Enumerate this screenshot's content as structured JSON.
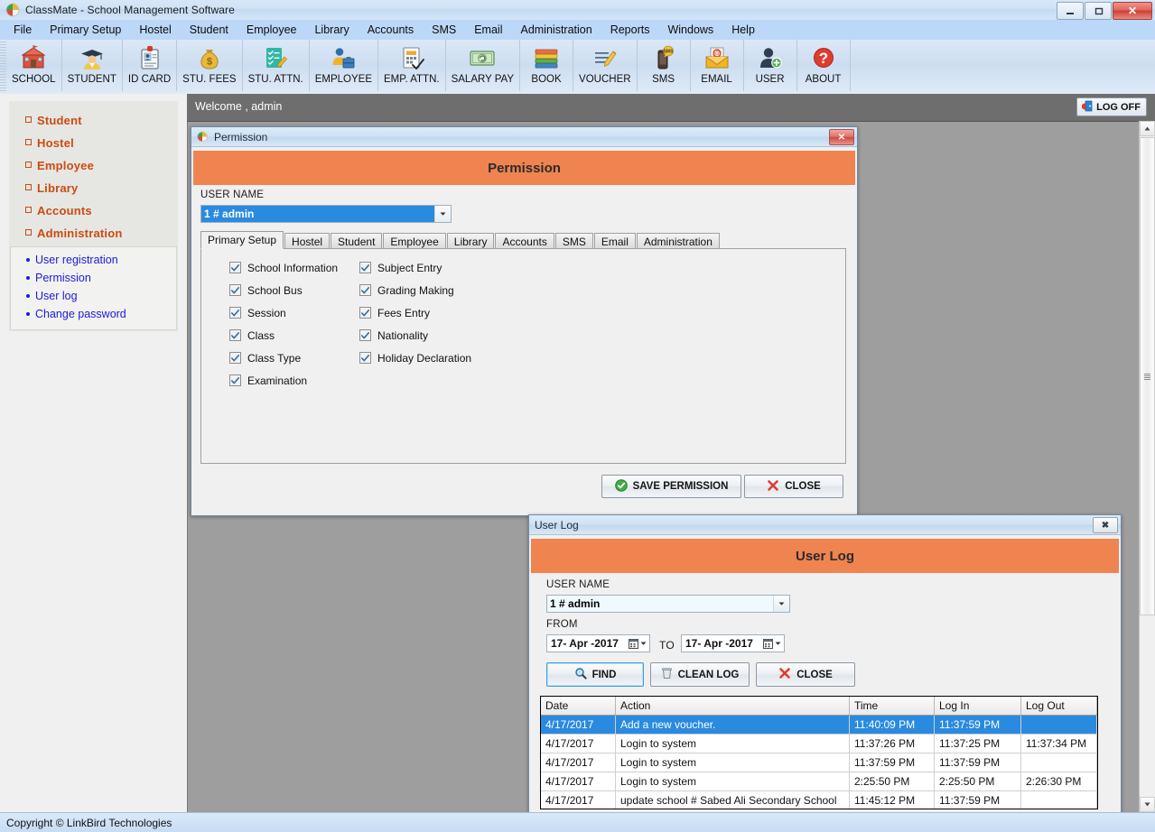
{
  "app": {
    "title": "ClassMate - School Management Software",
    "icon": "app-logo-icon",
    "window_buttons": {
      "minimize": "—",
      "maximize": "❐",
      "close": "✕"
    }
  },
  "menu": {
    "items": [
      "File",
      "Primary Setup",
      "Hostel",
      "Student",
      "Employee",
      "Library",
      "Accounts",
      "SMS",
      "Email",
      "Administration",
      "Reports",
      "Windows",
      "Help"
    ]
  },
  "toolbar": {
    "buttons": [
      {
        "label": "SCHOOL",
        "icon": "school-building-icon"
      },
      {
        "label": "STUDENT",
        "icon": "graduate-student-icon"
      },
      {
        "label": "ID CARD",
        "icon": "id-card-icon"
      },
      {
        "label": "STU. FEES",
        "icon": "money-bag-icon"
      },
      {
        "label": "STU. ATTN.",
        "icon": "checklist-pencil-icon"
      },
      {
        "label": "EMPLOYEE",
        "icon": "employee-badge-icon"
      },
      {
        "label": "EMP. ATTN.",
        "icon": "document-check-icon"
      },
      {
        "label": "SALARY PAY",
        "icon": "banknote-icon"
      },
      {
        "label": "BOOK",
        "icon": "books-stack-icon"
      },
      {
        "label": "VOUCHER",
        "icon": "voucher-pencil-icon"
      },
      {
        "label": "SMS",
        "icon": "sms-phone-icon"
      },
      {
        "label": "EMAIL",
        "icon": "email-envelope-icon"
      },
      {
        "label": "USER",
        "icon": "user-add-icon"
      },
      {
        "label": "ABOUT",
        "icon": "help-question-icon"
      }
    ]
  },
  "sidebar": {
    "main_items": [
      {
        "label": "Student"
      },
      {
        "label": "Hostel"
      },
      {
        "label": "Employee"
      },
      {
        "label": "Library"
      },
      {
        "label": "Accounts"
      },
      {
        "label": "Administration"
      }
    ],
    "sub_items": [
      {
        "label": "User registration"
      },
      {
        "label": "Permission"
      },
      {
        "label": "User log"
      },
      {
        "label": "Change password"
      }
    ]
  },
  "welcome": {
    "text": "Welcome ,  admin",
    "logoff_label": "LOG OFF",
    "logoff_icon": "logoff-door-icon"
  },
  "permission_window": {
    "titlebar_text": "Permission",
    "titlebar_icon": "app-logo-icon",
    "close_glyph": "✕",
    "header_title": "Permission",
    "user_name_label": "USER NAME",
    "user_name_value": "1 # admin",
    "tabs": [
      {
        "label": "Primary Setup",
        "active": true
      },
      {
        "label": "Hostel",
        "active": false
      },
      {
        "label": "Student",
        "active": false
      },
      {
        "label": "Employee",
        "active": false
      },
      {
        "label": "Library",
        "active": false
      },
      {
        "label": "Accounts",
        "active": false
      },
      {
        "label": "SMS",
        "active": false
      },
      {
        "label": "Email",
        "active": false
      },
      {
        "label": "Administration",
        "active": false
      }
    ],
    "checkboxes_col1": [
      {
        "label": "School Information",
        "checked": true
      },
      {
        "label": "School Bus",
        "checked": true
      },
      {
        "label": "Session",
        "checked": true
      },
      {
        "label": "Class",
        "checked": true
      },
      {
        "label": "Class Type",
        "checked": true
      },
      {
        "label": "Examination",
        "checked": true
      }
    ],
    "checkboxes_col2": [
      {
        "label": "Subject Entry",
        "checked": true
      },
      {
        "label": "Grading Making",
        "checked": true
      },
      {
        "label": "Fees Entry",
        "checked": true
      },
      {
        "label": "Nationality",
        "checked": true
      },
      {
        "label": "Holiday Declaration",
        "checked": true
      }
    ],
    "save_label": "SAVE PERMISSION",
    "save_icon": "green-check-circle-icon",
    "close_label": "CLOSE",
    "close_icon": "red-x-icon"
  },
  "userlog_window": {
    "titlebar_text": "User Log",
    "close_glyph": "✖",
    "header_title": "User Log",
    "user_name_label": "USER NAME",
    "user_name_value": "1 # admin",
    "from_label": "FROM",
    "from_value": "17- Apr -2017",
    "to_label": "TO",
    "to_value": "17- Apr -2017",
    "find_label": "FIND",
    "find_icon": "magnifier-icon",
    "clean_label": "CLEAN LOG",
    "clean_icon": "trash-bin-icon",
    "close_label": "CLOSE",
    "close_icon": "red-x-icon",
    "table": {
      "columns": [
        "Date",
        "Action",
        "Time",
        "Log In",
        "Log Out"
      ],
      "rows": [
        {
          "cells": [
            "4/17/2017",
            "Add a new voucher.",
            "11:40:09 PM",
            "11:37:59 PM",
            ""
          ],
          "selected": true
        },
        {
          "cells": [
            "4/17/2017",
            "Login to system",
            "11:37:26 PM",
            "11:37:25 PM",
            "11:37:34 PM"
          ],
          "selected": false
        },
        {
          "cells": [
            "4/17/2017",
            "Login to system",
            "11:37:59 PM",
            "11:37:59 PM",
            ""
          ],
          "selected": false
        },
        {
          "cells": [
            "4/17/2017",
            "Login to system",
            "2:25:50 PM",
            "2:25:50 PM",
            "2:26:30 PM"
          ],
          "selected": false
        },
        {
          "cells": [
            "4/17/2017",
            "update  school  # Sabed Ali Secondary School",
            "11:45:12 PM",
            "11:37:59 PM",
            ""
          ],
          "selected": false
        }
      ]
    }
  },
  "footer": {
    "text": "Copyright ©  LinkBird Technologies"
  },
  "colors": {
    "accent_orange": "#ef8450",
    "menu_blue": "#bcd8f8",
    "nav_orange": "#cc4b10",
    "nav_blue": "#1b1bdd",
    "select_blue": "#2a8ae0",
    "workspace_gray": "#9e9e9e"
  }
}
